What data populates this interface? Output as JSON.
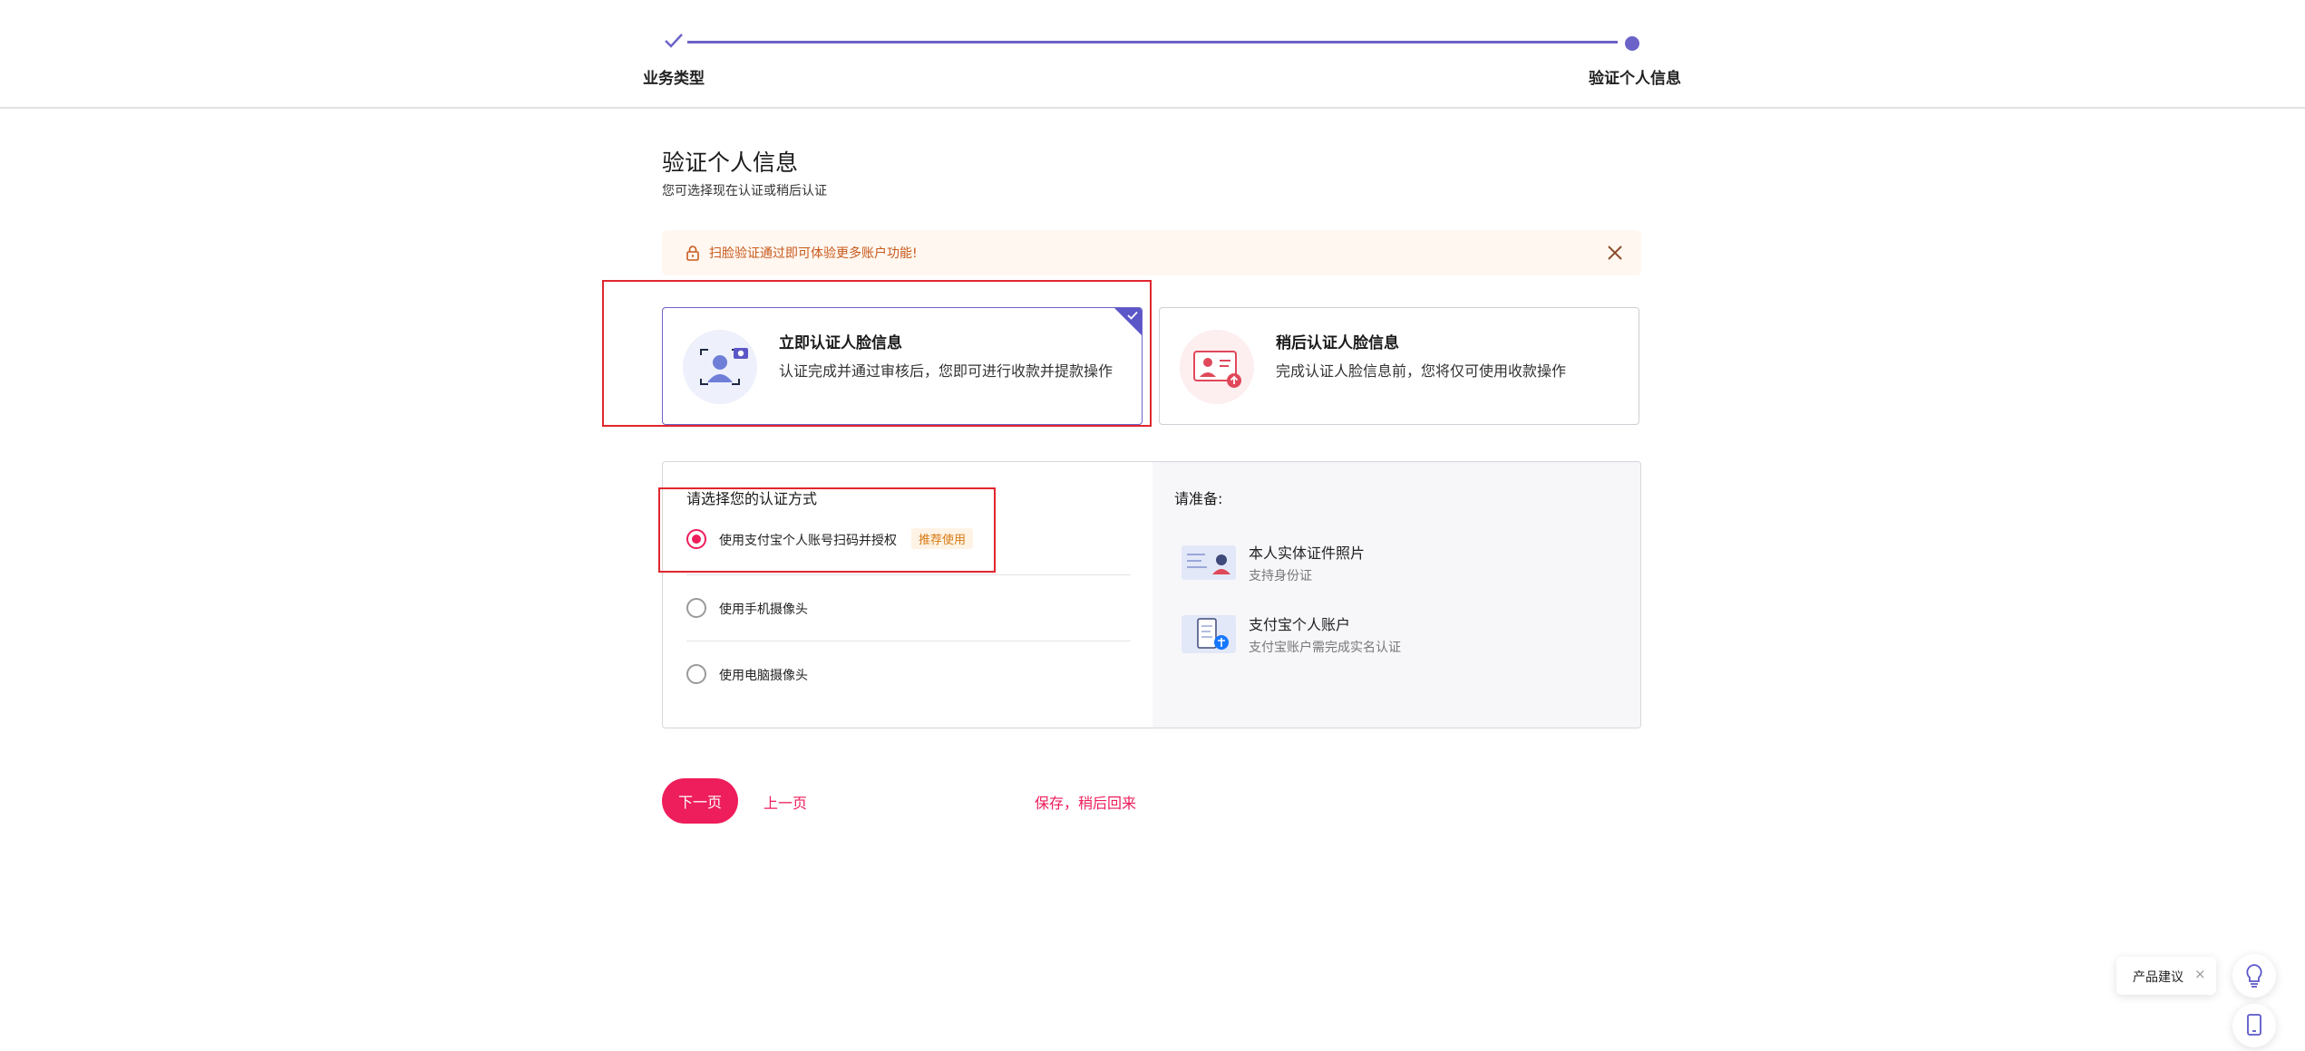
{
  "stepper": {
    "steps": [
      {
        "label": "业务类型",
        "state": "completed"
      },
      {
        "label": "验证个人信息",
        "state": "current"
      }
    ],
    "accent_color": "#6c63c9"
  },
  "header": {
    "title": "验证个人信息",
    "subtitle": "您可选择现在认证或稍后认证"
  },
  "notice": {
    "text": "扫脸验证通过即可体验更多账户功能!",
    "icon": "lock-icon",
    "close_icon": "close-icon"
  },
  "options": [
    {
      "title": "立即认证人脸信息",
      "desc": "认证完成并通过审核后，您即可进行收款并提款操作",
      "icon": "face-scan-icon",
      "selected": true
    },
    {
      "title": "稍后认证人脸信息",
      "desc": "完成认证人脸信息前，您将仅可使用收款操作",
      "icon": "id-card-upload-icon",
      "selected": false
    }
  ],
  "method": {
    "heading": "请选择您的认证方式",
    "items": [
      {
        "label": "使用支付宝个人账号扫码并授权",
        "badge": "推荐使用",
        "checked": true
      },
      {
        "label": "使用手机摄像头",
        "checked": false
      },
      {
        "label": "使用电脑摄像头",
        "checked": false
      }
    ]
  },
  "prepare": {
    "title": "请准备:",
    "items": [
      {
        "title": "本人实体证件照片",
        "sub": "支持身份证",
        "icon": "id-document-icon"
      },
      {
        "title": "支付宝个人账户",
        "sub": "支付宝账户需完成实名认证",
        "icon": "alipay-account-icon"
      }
    ]
  },
  "actions": {
    "next": "下一页",
    "prev": "上一页",
    "save": "保存，稍后回来"
  },
  "feedback": {
    "label": "产品建议",
    "close": "×"
  },
  "colors": {
    "primary": "#ee1d5b",
    "accent": "#6c63c9",
    "annotation": "#e0262e"
  }
}
